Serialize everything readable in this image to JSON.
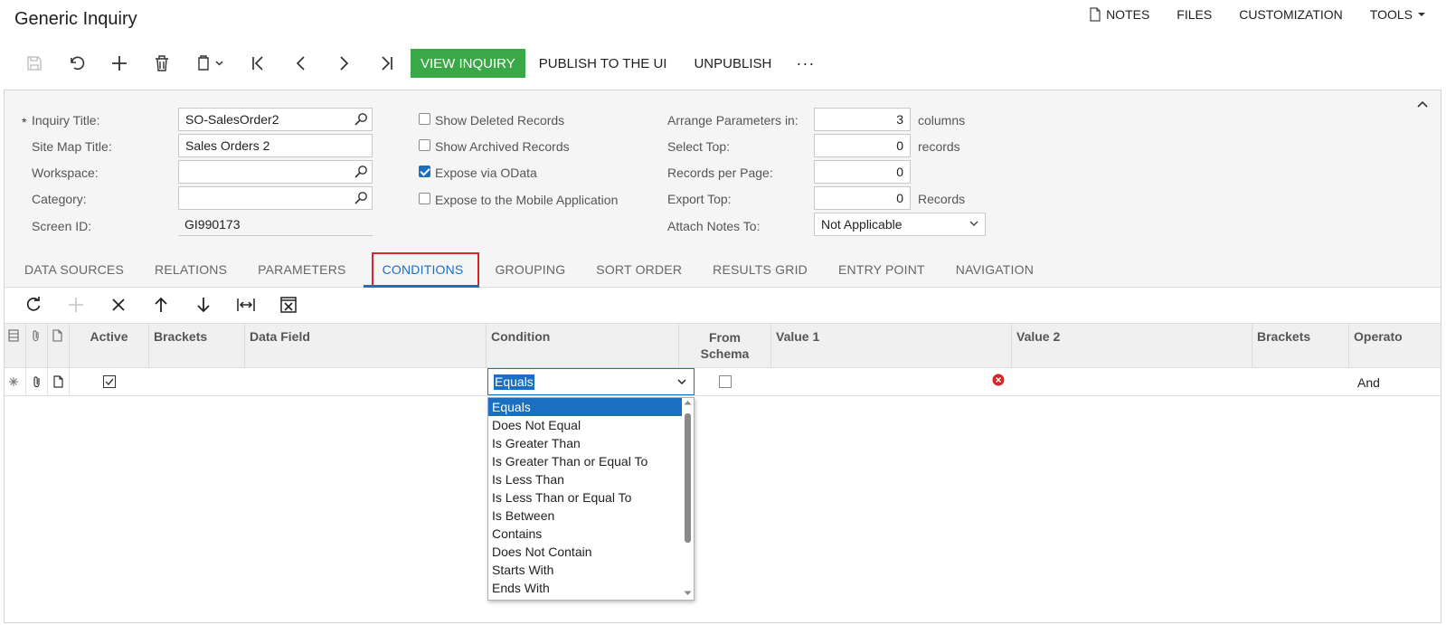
{
  "page": {
    "title": "Generic Inquiry"
  },
  "topmenu": {
    "notes": "NOTES",
    "files": "FILES",
    "customization": "CUSTOMIZATION",
    "tools": "TOOLS"
  },
  "toolbar": {
    "view_inquiry": "VIEW INQUIRY",
    "publish": "PUBLISH TO THE UI",
    "unpublish": "UNPUBLISH",
    "more": "···"
  },
  "form": {
    "inquiry_title": {
      "label": "Inquiry Title:",
      "required_mark": "*",
      "value": "SO-SalesOrder2"
    },
    "site_map_title": {
      "label": "Site Map Title:",
      "value": "Sales Orders 2"
    },
    "workspace": {
      "label": "Workspace:",
      "value": ""
    },
    "category": {
      "label": "Category:",
      "value": ""
    },
    "screen_id": {
      "label": "Screen ID:",
      "value": "GI990173"
    },
    "checkboxes": [
      {
        "label": "Show Deleted Records",
        "checked": false
      },
      {
        "label": "Show Archived Records",
        "checked": false
      },
      {
        "label": "Expose via OData",
        "checked": true
      },
      {
        "label": "Expose to the Mobile Application",
        "checked": false
      }
    ],
    "arrange_params": {
      "label": "Arrange Parameters in:",
      "value": "3",
      "unit": "columns"
    },
    "select_top": {
      "label": "Select Top:",
      "value": "0",
      "unit": "records"
    },
    "records_per_page": {
      "label": "Records per Page:",
      "value": "0"
    },
    "export_top": {
      "label": "Export Top:",
      "value": "0",
      "unit": "Records"
    },
    "attach_notes": {
      "label": "Attach Notes To:",
      "value": "Not Applicable"
    }
  },
  "tabs": [
    "DATA SOURCES",
    "RELATIONS",
    "PARAMETERS",
    "CONDITIONS",
    "GROUPING",
    "SORT ORDER",
    "RESULTS GRID",
    "ENTRY POINT",
    "NAVIGATION"
  ],
  "active_tab": "CONDITIONS",
  "grid": {
    "headers": {
      "active": "Active",
      "brackets": "Brackets",
      "data_field": "Data Field",
      "condition": "Condition",
      "from_schema": "From Schema",
      "value1": "Value 1",
      "value2": "Value 2",
      "brackets2": "Brackets",
      "operator": "Operato"
    },
    "row": {
      "active": true,
      "condition": "Equals",
      "from_schema": false,
      "operator": "And"
    }
  },
  "condition_options": [
    "Equals",
    "Does Not Equal",
    "Is Greater Than",
    "Is Greater Than or Equal To",
    "Is Less Than",
    "Is Less Than or Equal To",
    "Is Between",
    "Contains",
    "Does Not Contain",
    "Starts With",
    "Ends With"
  ],
  "colors": {
    "green": "#3aa846",
    "accent": "#1a6fc2",
    "highlight": "#d9262d",
    "error": "#d9262d"
  }
}
